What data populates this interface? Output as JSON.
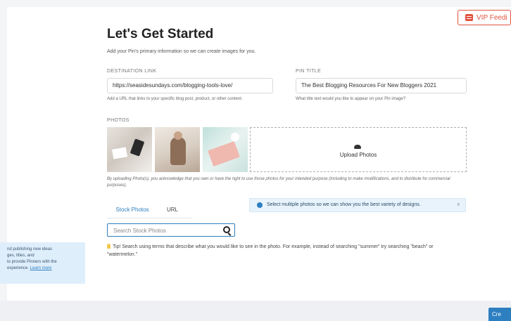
{
  "vip_feedback": "VIP Feedi",
  "page": {
    "title": "Let's Get Started",
    "subtitle": "Add your Pin's primary information so we can create images for you."
  },
  "destination": {
    "label": "DESTINATION LINK",
    "value": "https://seasidesundays.com/blogging-tools-love/",
    "hint": "Add a URL that links to your specific blog post, product, or other content."
  },
  "pin_title": {
    "label": "PIN TITLE",
    "value": "The Best Blogging Resources For New Bloggers 2021",
    "hint": "What title text would you like to appear on your Pin image?"
  },
  "photos": {
    "label": "PHOTOS",
    "upload_label": "Upload Photos",
    "disclaimer": "By uploading Photo(s), you acknowledge that you own or have the right to use those photos for your intended purpose (including to make modifications, and to distribute for commercial purposes)."
  },
  "tabs": [
    "Stock Photos",
    "URL"
  ],
  "info_banner": {
    "text": "Select multiple photos so we can show you the best variety of designs.",
    "close": "x"
  },
  "search": {
    "placeholder": "Search Stock Photos"
  },
  "tip": "Tip! Search using terms that describe what you would like to see in the photo. For example, instead of searching \"summer\" try searching \"beach\" or \"watermelon.\"",
  "side_panel": {
    "lines": [
      "nd publishing new ideas",
      "ges, titles, and",
      "to provide Pinners with the",
      "experience."
    ],
    "link": "Learn more"
  },
  "create_button": "Cre"
}
